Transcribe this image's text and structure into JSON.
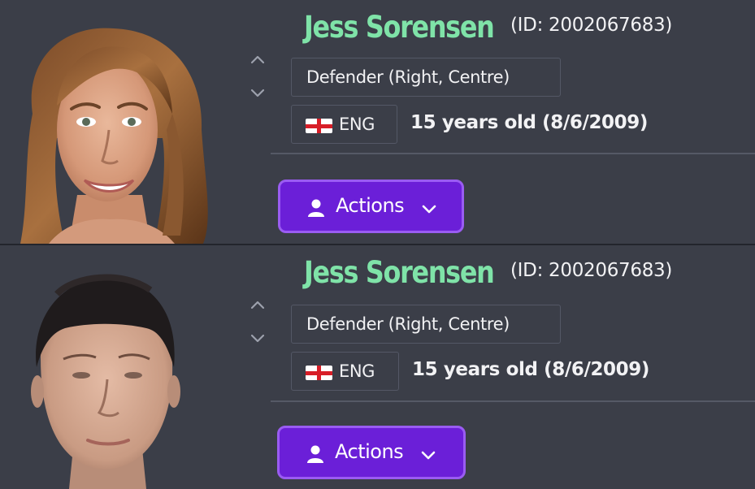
{
  "players": [
    {
      "name": "Jess Sorensen",
      "id_text": "(ID: 2002067683)",
      "position": "Defender (Right, Centre)",
      "nationality": "ENG",
      "flag_icon": "england-flag-icon",
      "age_text": "15 years old (8/6/2009)",
      "actions_label": "Actions",
      "portrait": "real-photo"
    },
    {
      "name": "Jess Sorensen",
      "id_text": "(ID: 2002067683)",
      "position": "Defender (Right, Centre)",
      "nationality": "ENG",
      "flag_icon": "england-flag-icon",
      "age_text": "15 years old (8/6/2009)",
      "actions_label": "Actions",
      "portrait": "generated-3d-face"
    }
  ],
  "colors": {
    "background": "#3b3e48",
    "name": "#7fe3a8",
    "button": "#6b1fd8",
    "button_border": "#9a5cf2",
    "text": "#f2f2f4"
  }
}
